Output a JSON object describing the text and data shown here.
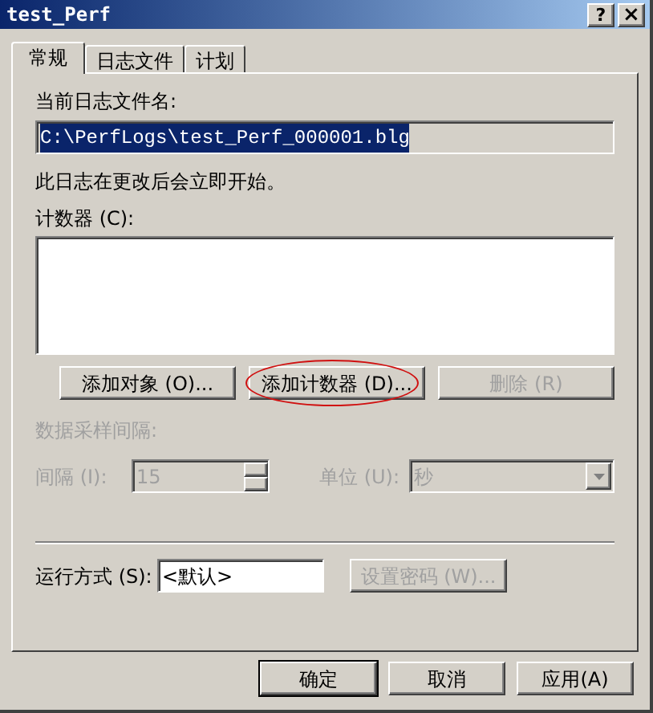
{
  "window": {
    "title": "test_Perf",
    "buttons": [
      {
        "kind": "help",
        "label": "?"
      },
      {
        "kind": "close",
        "label": "×"
      }
    ]
  },
  "tabs": [
    {
      "label": "常规",
      "selected": true
    },
    {
      "label": "日志文件",
      "selected": false
    },
    {
      "label": "计划",
      "selected": false
    }
  ],
  "log_file": {
    "label": "当前日志文件名:",
    "value": "C:\\PerfLogs\\test_Perf_000001.blg"
  },
  "notice": "此日志在更改后会立即开始。",
  "counters": {
    "label": "计数器 (C):",
    "buttons": [
      {
        "label": "添加对象 (O)...",
        "disabled": false,
        "highlighted": false
      },
      {
        "label": "添加计数器 (D)...",
        "disabled": false,
        "highlighted": true
      },
      {
        "label": "删除 (R)",
        "disabled": true,
        "highlighted": false
      }
    ]
  },
  "sampling": {
    "label": "数据采样间隔:",
    "disabled": true,
    "interval_label": "间隔 (I):",
    "interval_value": "15",
    "unit_label": "单位 (U):",
    "unit_value": "秒"
  },
  "run_as": {
    "label": "运行方式 (S):",
    "value": "<默认>",
    "password_button": {
      "label": "设置密码 (W)...",
      "disabled": true
    }
  },
  "footer_buttons": [
    {
      "label": "确定",
      "default": true
    },
    {
      "label": "取消",
      "default": false
    },
    {
      "label": "应用(A)",
      "default": false
    }
  ]
}
